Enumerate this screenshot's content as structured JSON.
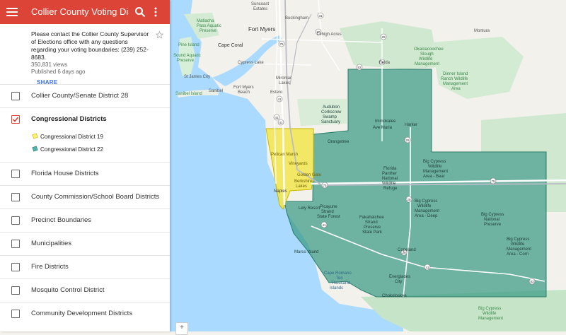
{
  "header": {
    "title": "Collier County Voting Distr"
  },
  "description": {
    "text": "Please contact the Collier County Supervisor of Elections office with any questions regarding your voting boundaries: (239) 252-8683.",
    "views": "350,831 views",
    "published": "Published 6 days ago",
    "share_label": "SHARE"
  },
  "layers": [
    {
      "label": "Collier County/Senate District 28",
      "checked": false
    },
    {
      "label": "Congressional Districts",
      "checked": true,
      "items": [
        {
          "label": "Congressional District 19",
          "color": "#fff176"
        },
        {
          "label": "Congressional District 22",
          "color": "#4db6ac"
        }
      ]
    },
    {
      "label": "Florida House Districts",
      "checked": false
    },
    {
      "label": "County Commission/School Board Districts",
      "checked": false
    },
    {
      "label": "Precinct Boundaries",
      "checked": false
    },
    {
      "label": "Municipalities",
      "checked": false
    },
    {
      "label": "Fire Districts",
      "checked": false
    },
    {
      "label": "Mosquito Control District",
      "checked": false
    },
    {
      "label": "Community Development Districts",
      "checked": false
    }
  ],
  "map": {
    "colors": {
      "water": "#aadaff",
      "land": "#f5f3ee",
      "park": "#c8e6c9",
      "district19": "#f2e64d",
      "district22": "#3a9a83",
      "road": "#ffffff",
      "highway": "#c7cad3"
    },
    "labels": {
      "suncoast": "Suncoast",
      "estates": "Estates",
      "buckingham": "Buckingham",
      "matlacha": "Matlacha",
      "pass_aquatic": "Pass Aquatic",
      "preserve1": "Preserve",
      "fort_myers": "Fort Myers",
      "lehigh": "Lehigh Acres",
      "montura": "Montura",
      "cape_coral": "Cape Coral",
      "pine_island1": "Pine Island",
      "sound_aquatic": "Sound Aquatic",
      "preserve2": "Preserve",
      "cypress_lake": "Cypress Lake",
      "okaloacoochee1": "Okaloacoochee",
      "okaloacoochee2": "Slough",
      "okaloacoochee3": "Wildlife",
      "okaloacoochee4": "Management",
      "felda": "Felda",
      "st_james": "St James City",
      "miromar1": "Miromar",
      "miromar2": "Lakes",
      "sanibel": "Sanibel Island",
      "sanibel2": "Sanibel",
      "fort_myers_beach1": "Fort Myers",
      "fort_myers_beach2": "Beach",
      "estero": "Estero",
      "dinner_island1": "Dinner Island",
      "dinner_island2": "Ranch Wildlife",
      "dinner_island3": "Management",
      "dinner_island4": "Area",
      "immokalee": "Immokalee",
      "audubon1": "Audubon",
      "audubon2": "Corkscrew",
      "audubon3": "Swamp",
      "audubon4": "Sanctuary",
      "ave_maria": "Ave Maria",
      "harker": "Harker",
      "orangetree": "Orangetree",
      "pelican_marsh": "Pelican Marsh",
      "vineyards": "Vineyards",
      "golden_gate": "Golden Gate",
      "berkshire1": "Berkshire",
      "berkshire2": "Lakes",
      "naples": "Naples",
      "florida_panther1": "Florida",
      "florida_panther2": "Panther",
      "florida_panther3": "National",
      "florida_panther4": "Wildlife",
      "florida_panther5": "Refuge",
      "big_cypress_bear1": "Big Cypress",
      "big_cypress_bear2": "Wildlife",
      "big_cypress_bear3": "Management",
      "big_cypress_bear4": "Area - Bear",
      "lely": "Lely Resort",
      "picayune1": "Picayune",
      "picayune2": "Strand",
      "picayune3": "State Forest",
      "bcwma_deep1": "Big Cypress",
      "bcwma_deep2": "Wildlife",
      "bcwma_deep3": "Management",
      "bcwma_deep4": "Area - Deep",
      "fakahatchee1": "Fakahatchee",
      "fakahatchee2": "Strand",
      "fakahatchee3": "Preserve",
      "fakahatchee4": "State Park",
      "big_cypress_np1": "Big Cypress",
      "big_cypress_np2": "National",
      "big_cypress_np3": "Preserve",
      "big_cypress_corn1": "Big Cypress",
      "big_cypress_corn2": "Wildlife",
      "big_cypress_corn3": "Management",
      "big_cypress_corn4": "Area - Corn",
      "marco": "Marco Island",
      "copeland": "Copeland",
      "everglades1": "Everglades",
      "everglades2": "City",
      "cape_romano1": "Cape Romano",
      "cape_romano2": "Ten",
      "cape_romano3": "Thousand",
      "cape_romano4": "Islands",
      "chokoloskee": "Chokoloskee",
      "big_cypress_bottom1": "Big Cypress",
      "big_cypress_bottom2": "Wildlife",
      "big_cypress_bottom3": "Management"
    },
    "shields": [
      "75",
      "41",
      "29",
      "82",
      "31",
      "80",
      "41",
      "29",
      "75",
      "29",
      "41",
      "29",
      "41",
      "83",
      "75",
      "29",
      "41"
    ]
  },
  "icons": {
    "menu": "menu-icon",
    "search": "search-icon",
    "more": "more-vert-icon",
    "star": "star-icon",
    "checkbox_checked": "check-icon"
  }
}
